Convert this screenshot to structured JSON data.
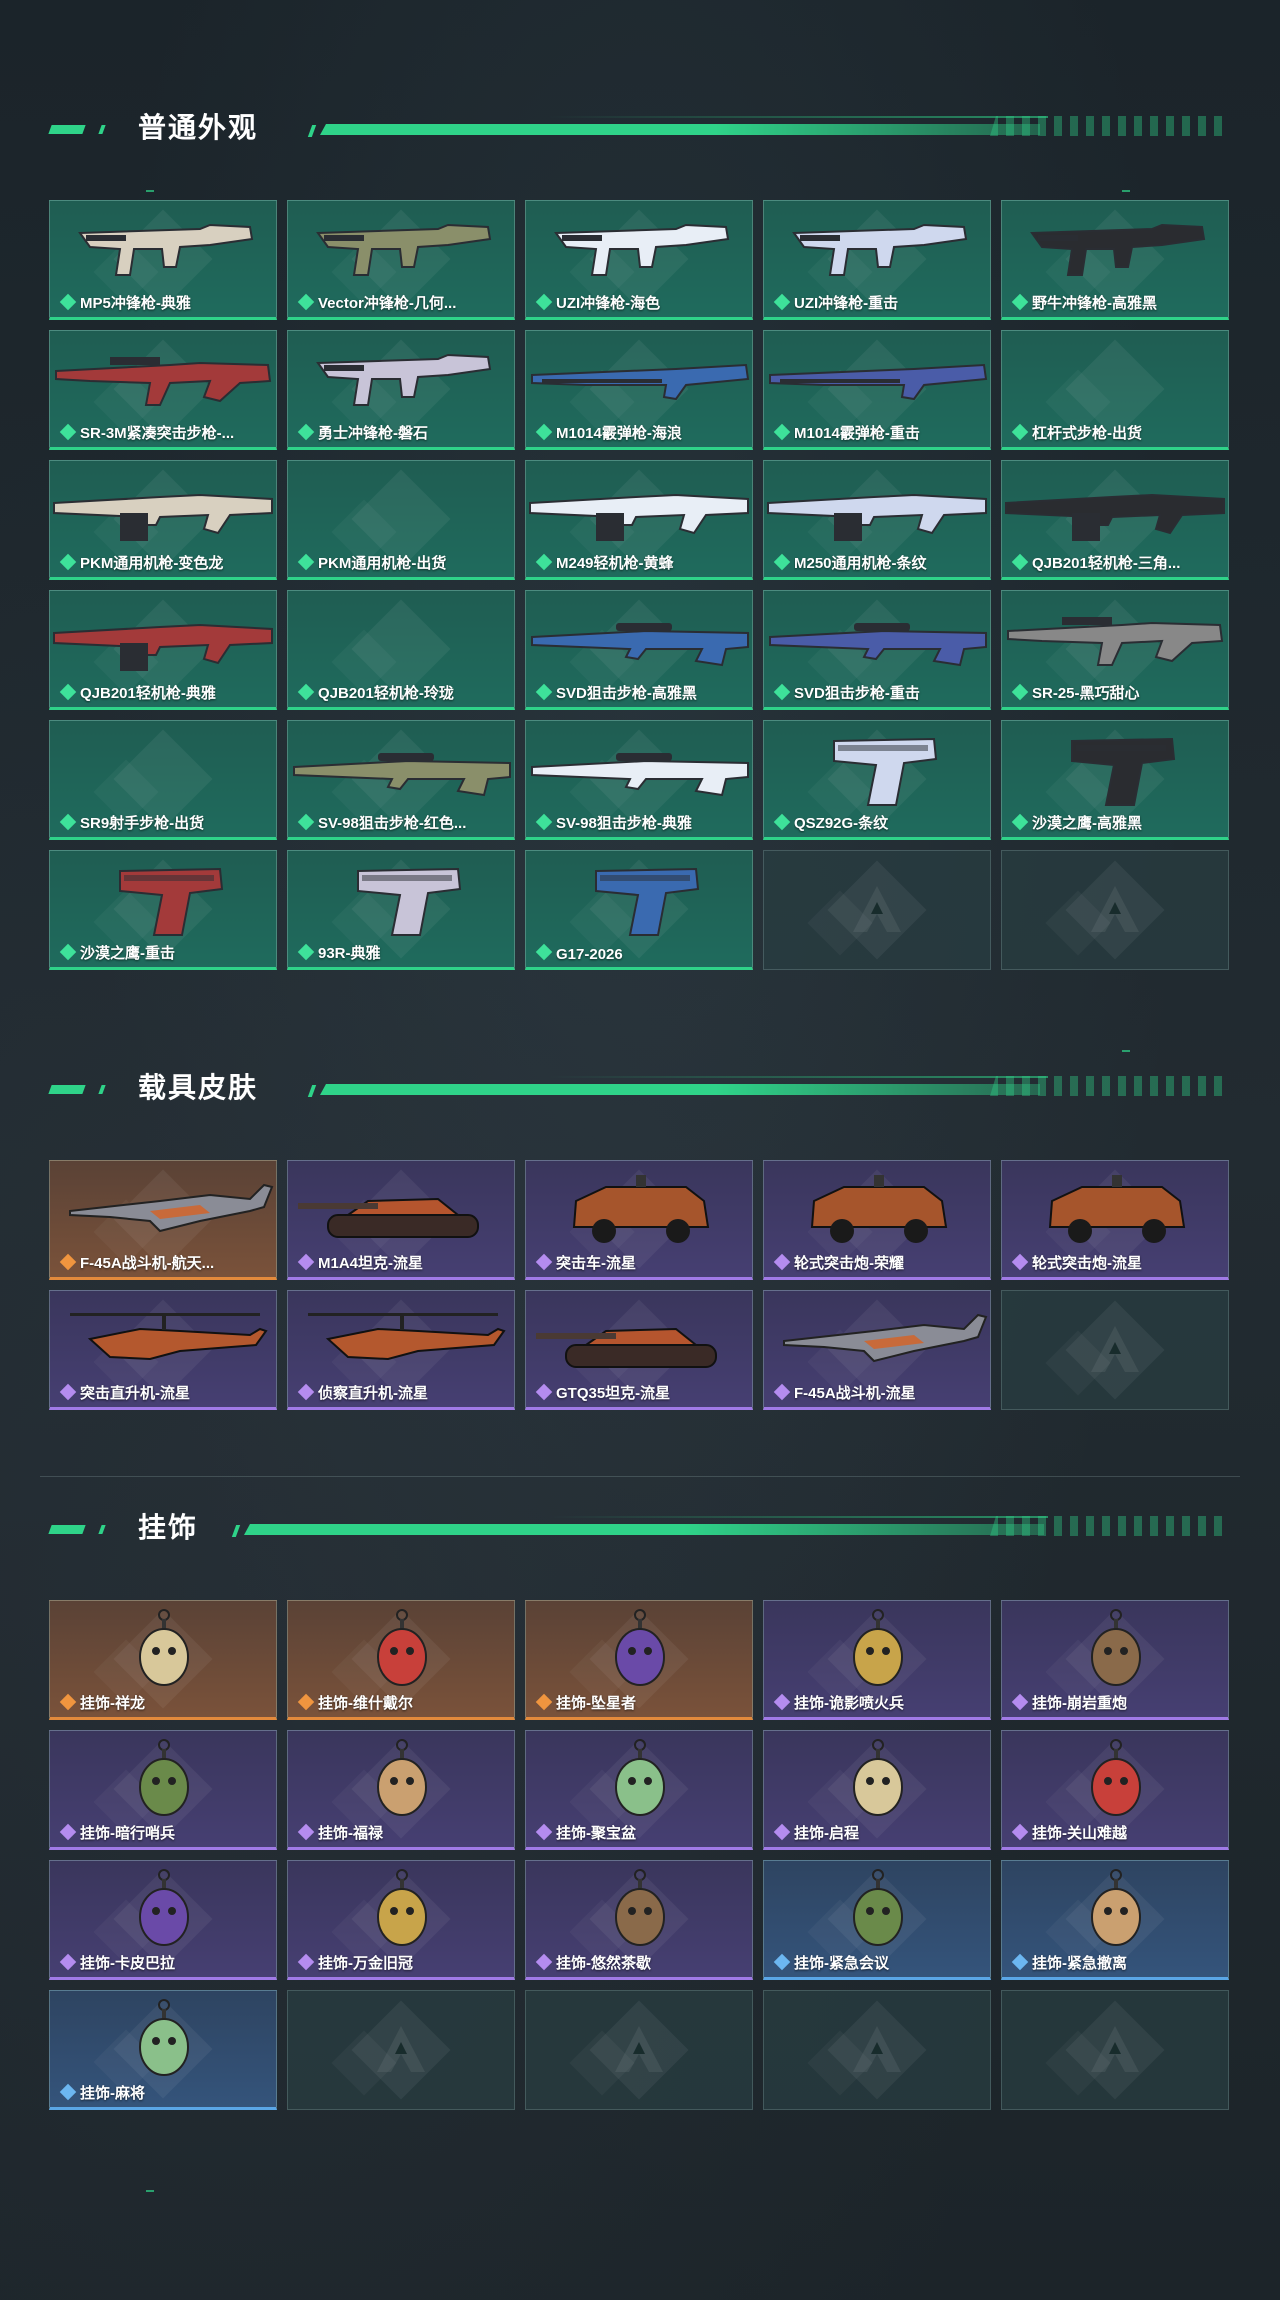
{
  "sections": {
    "weapons": {
      "title": "普通外观",
      "items": [
        {
          "name": "MP5冲锋枪-典雅",
          "rarity": "green",
          "icon": "smg-icon"
        },
        {
          "name": "Vector冲锋枪-几何...",
          "rarity": "green",
          "icon": "smg-icon"
        },
        {
          "name": "UZI冲锋枪-海色",
          "rarity": "green",
          "icon": "smg-icon"
        },
        {
          "name": "UZI冲锋枪-重击",
          "rarity": "green",
          "icon": "smg-icon"
        },
        {
          "name": "野牛冲锋枪-高雅黑",
          "rarity": "green",
          "icon": "smg-icon"
        },
        {
          "name": "SR-3M紧凑突击步枪-...",
          "rarity": "green",
          "icon": "rifle-icon"
        },
        {
          "name": "勇士冲锋枪-磐石",
          "rarity": "green",
          "icon": "smg-icon"
        },
        {
          "name": "M1014霰弹枪-海浪",
          "rarity": "green",
          "icon": "shotgun-icon"
        },
        {
          "name": "M1014霰弹枪-重击",
          "rarity": "green",
          "icon": "shotgun-icon"
        },
        {
          "name": "杠杆式步枪-出货",
          "rarity": "green",
          "icon": ""
        },
        {
          "name": "PKM通用机枪-变色龙",
          "rarity": "green",
          "icon": "machinegun-icon"
        },
        {
          "name": "PKM通用机枪-出货",
          "rarity": "green",
          "icon": ""
        },
        {
          "name": "M249轻机枪-黄蜂",
          "rarity": "green",
          "icon": "machinegun-icon"
        },
        {
          "name": "M250通用机枪-条纹",
          "rarity": "green",
          "icon": "machinegun-icon"
        },
        {
          "name": "QJB201轻机枪-三角...",
          "rarity": "green",
          "icon": "machinegun-icon"
        },
        {
          "name": "QJB201轻机枪-典雅",
          "rarity": "green",
          "icon": "machinegun-icon"
        },
        {
          "name": "QJB201轻机枪-玲珑",
          "rarity": "green",
          "icon": ""
        },
        {
          "name": "SVD狙击步枪-高雅黑",
          "rarity": "green",
          "icon": "sniper-icon"
        },
        {
          "name": "SVD狙击步枪-重击",
          "rarity": "green",
          "icon": "sniper-icon"
        },
        {
          "name": "SR-25-黑巧甜心",
          "rarity": "green",
          "icon": "rifle-icon"
        },
        {
          "name": "SR9射手步枪-出货",
          "rarity": "green",
          "icon": ""
        },
        {
          "name": "SV-98狙击步枪-红色...",
          "rarity": "green",
          "icon": "sniper-icon"
        },
        {
          "name": "SV-98狙击步枪-典雅",
          "rarity": "green",
          "icon": "sniper-icon"
        },
        {
          "name": "QSZ92G-条纹",
          "rarity": "green",
          "icon": "pistol-icon"
        },
        {
          "name": "沙漠之鹰-高雅黑",
          "rarity": "green",
          "icon": "pistol-icon"
        },
        {
          "name": "沙漠之鹰-重击",
          "rarity": "green",
          "icon": "pistol-icon"
        },
        {
          "name": "93R-典雅",
          "rarity": "green",
          "icon": "pistol-icon"
        },
        {
          "name": "G17-2026",
          "rarity": "green",
          "icon": "pistol-icon"
        },
        {
          "name": "",
          "rarity": "empty",
          "icon": "logo-icon"
        },
        {
          "name": "",
          "rarity": "empty",
          "icon": "logo-icon"
        }
      ]
    },
    "vehicles": {
      "title": "载具皮肤",
      "items": [
        {
          "name": "F-45A战斗机-航天...",
          "rarity": "orange",
          "icon": "jet-icon"
        },
        {
          "name": "M1A4坦克-流星",
          "rarity": "purple",
          "icon": "tank-icon"
        },
        {
          "name": "突击车-流星",
          "rarity": "purple",
          "icon": "truck-icon"
        },
        {
          "name": "轮式突击炮-荣耀",
          "rarity": "purple",
          "icon": "truck-icon"
        },
        {
          "name": "轮式突击炮-流星",
          "rarity": "purple",
          "icon": "truck-icon"
        },
        {
          "name": "突击直升机-流星",
          "rarity": "purple",
          "icon": "helicopter-icon"
        },
        {
          "name": "侦察直升机-流星",
          "rarity": "purple",
          "icon": "helicopter-icon"
        },
        {
          "name": "GTQ35坦克-流星",
          "rarity": "purple",
          "icon": "tank-icon"
        },
        {
          "name": "F-45A战斗机-流星",
          "rarity": "purple",
          "icon": "jet-icon"
        },
        {
          "name": "",
          "rarity": "empty",
          "icon": "logo-icon"
        }
      ]
    },
    "charms": {
      "title": "挂饰",
      "items": [
        {
          "name": "挂饰-祥龙",
          "rarity": "orange",
          "icon": "charm-icon"
        },
        {
          "name": "挂饰-维什戴尔",
          "rarity": "orange",
          "icon": "charm-icon"
        },
        {
          "name": "挂饰-坠星者",
          "rarity": "orange",
          "icon": "charm-icon"
        },
        {
          "name": "挂饰-诡影喷火兵",
          "rarity": "purple",
          "icon": "charm-icon"
        },
        {
          "name": "挂饰-崩岩重炮",
          "rarity": "purple",
          "icon": "charm-icon"
        },
        {
          "name": "挂饰-暗行哨兵",
          "rarity": "purple",
          "icon": "charm-icon"
        },
        {
          "name": "挂饰-福禄",
          "rarity": "purple",
          "icon": "charm-icon"
        },
        {
          "name": "挂饰-聚宝盆",
          "rarity": "purple",
          "icon": "charm-icon"
        },
        {
          "name": "挂饰-启程",
          "rarity": "purple",
          "icon": "charm-icon"
        },
        {
          "name": "挂饰-关山难越",
          "rarity": "purple",
          "icon": "charm-icon"
        },
        {
          "name": "挂饰-卡皮巴拉",
          "rarity": "purple",
          "icon": "charm-icon"
        },
        {
          "name": "挂饰-万金旧冠",
          "rarity": "purple",
          "icon": "charm-icon"
        },
        {
          "name": "挂饰-悠然茶歇",
          "rarity": "purple",
          "icon": "charm-icon"
        },
        {
          "name": "挂饰-紧急会议",
          "rarity": "blue",
          "icon": "charm-icon"
        },
        {
          "name": "挂饰-紧急撤离",
          "rarity": "blue",
          "icon": "charm-icon"
        },
        {
          "name": "挂饰-麻将",
          "rarity": "blue",
          "icon": "charm-icon"
        },
        {
          "name": "",
          "rarity": "empty",
          "icon": "logo-icon"
        },
        {
          "name": "",
          "rarity": "empty",
          "icon": "logo-icon"
        },
        {
          "name": "",
          "rarity": "empty",
          "icon": "logo-icon"
        },
        {
          "name": "",
          "rarity": "empty",
          "icon": "logo-icon"
        }
      ]
    }
  },
  "colors": {
    "accent_green": "#2fd389",
    "rarity_green": "#3ee29a",
    "rarity_orange": "#f0953f",
    "rarity_purple": "#b58cf0",
    "rarity_blue": "#6cb6f0"
  }
}
